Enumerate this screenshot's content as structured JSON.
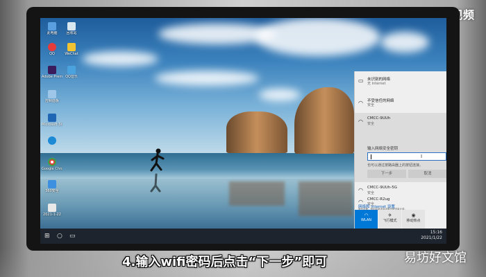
{
  "watermark_top": "天奇·视频",
  "watermark_bottom": "易坊好文馆",
  "caption": "4.输入wifi密码后点击“下一步”即可",
  "desktop": {
    "icons": [
      {
        "label": "此电脑"
      },
      {
        "label": "回收站"
      },
      {
        "label": "QQ"
      },
      {
        "label": "WeChat"
      },
      {
        "label": "Adobe Premiere"
      },
      {
        "label": "QQ音乐"
      },
      {
        "label": "控制面板"
      },
      {
        "label": "Microsoft Store"
      },
      {
        "label": "Google Chrome"
      },
      {
        "label": "360安全"
      },
      {
        "label": "2021-1-22"
      }
    ]
  },
  "wifi_panel": {
    "connected": {
      "name": "未识别的网络",
      "status": "无 Internet"
    },
    "networks": [
      {
        "name": "不受信任的网络",
        "status": "安全"
      },
      {
        "name": "CMCC-9UUh",
        "status": "安全"
      }
    ],
    "password_prompt": "输入网络安全密钥",
    "password_value": "",
    "hint": "也可以通过按路由器上的按钮连接。",
    "next_button": "下一步",
    "cancel_button": "取消",
    "more_networks": [
      {
        "name": "CMCC-9UUh-5G",
        "status": "安全"
      },
      {
        "name": "CMCC-R2ug",
        "status": "安全"
      }
    ],
    "settings_link": "网络和 Internet 设置",
    "settings_sub": "更改设置，例如将某连接设置为按流量计费。",
    "tiles": [
      {
        "label": "WLAN",
        "active": true
      },
      {
        "label": "飞行模式",
        "active": false
      },
      {
        "label": "移动热点",
        "active": false
      }
    ]
  },
  "taskbar": {
    "start_icon": "windows-icon",
    "time": "15:16",
    "date": "2021/1/22"
  },
  "colors": {
    "accent": "#0078d7",
    "caption_text": "#ffffff"
  }
}
